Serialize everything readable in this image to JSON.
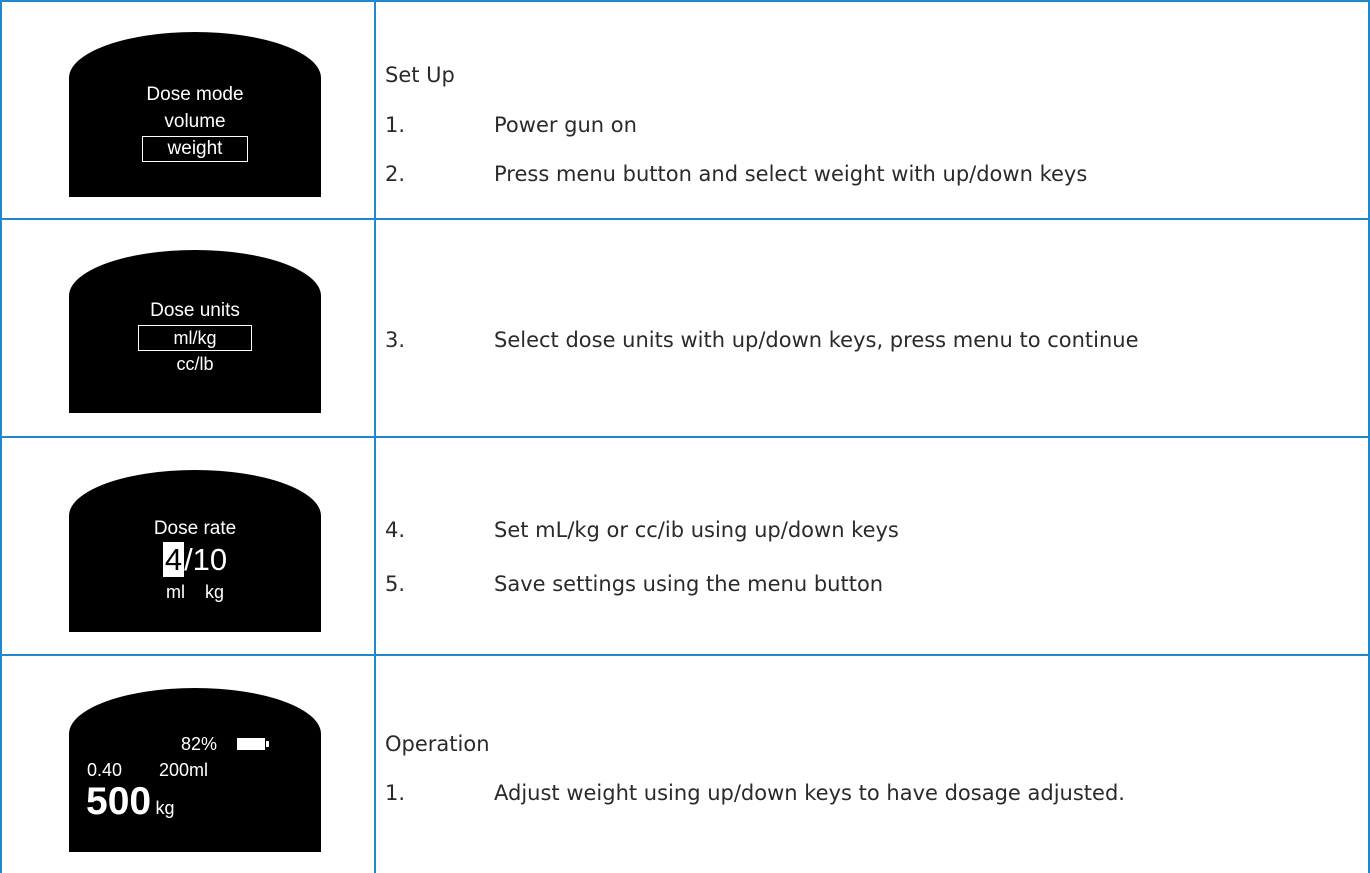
{
  "rows": [
    {
      "screen": {
        "line1": "Dose mode",
        "line2": "volume",
        "line3": "weight"
      },
      "header": "Set Up",
      "steps": [
        {
          "num": "1.",
          "text": "Power gun on"
        },
        {
          "num": "2.",
          "text": "Press menu button and select weight with up/down keys"
        }
      ]
    },
    {
      "screen": {
        "line1": "Dose units",
        "line2": "ml/kg",
        "line3": "cc/lb"
      },
      "steps": [
        {
          "num": "3.",
          "text": "Select dose units with up/down keys, press menu to continue"
        }
      ]
    },
    {
      "screen": {
        "line1": "Dose rate",
        "value_hl": "4",
        "value_rest": "/10",
        "unit1": "ml",
        "unit2": "kg"
      },
      "steps": [
        {
          "num": "4.",
          "text": "Set mL/kg or cc/ib using up/down keys"
        },
        {
          "num": "5.",
          "text": "Save settings using the menu button"
        }
      ]
    },
    {
      "screen": {
        "battery_pct": "82%",
        "rate": "0.40",
        "volume": "200ml",
        "weight": "500",
        "weight_unit": "kg"
      },
      "header": "Operation",
      "steps": [
        {
          "num": "1.",
          "text": "Adjust weight using up/down keys to have dosage adjusted."
        }
      ]
    }
  ],
  "colors": {
    "border": "#1e88c8",
    "screen_bg": "#000000",
    "screen_fg": "#ffffff"
  },
  "battery_level": 0.82
}
